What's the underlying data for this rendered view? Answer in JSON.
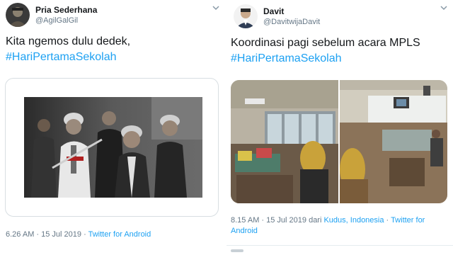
{
  "tweets": [
    {
      "name": "Pria Sederhana",
      "handle": "@AgilGalGil",
      "text": "Kita ngemos dulu dedek,",
      "hashtag": "#HariPertamaSekolah",
      "timestamp": "6.26 AM · 15 Jul 2019 · ",
      "source": "Twitter for Android",
      "avatar_icon": "avatar-photo",
      "media_icon": "group-selfie-photo"
    },
    {
      "name": "Davit",
      "handle": "@DavitwijaDavit",
      "text": "Koordinasi pagi sebelum acara MPLS",
      "hashtag": "#HariPertamaSekolah",
      "timestamp": "8.15 AM · 15 Jul 2019 dari ",
      "location": "Kudus, Indonesia",
      "separator": " · ",
      "source": "Twitter for Android",
      "avatar_icon": "avatar-photo",
      "media_icon": "classroom-photo"
    }
  ],
  "colors": {
    "link": "#1da1f2",
    "secondary_text": "#657786",
    "primary_text": "#14171a",
    "border": "#d8dee2"
  },
  "icons": {
    "caret": "chevron-down-icon"
  }
}
